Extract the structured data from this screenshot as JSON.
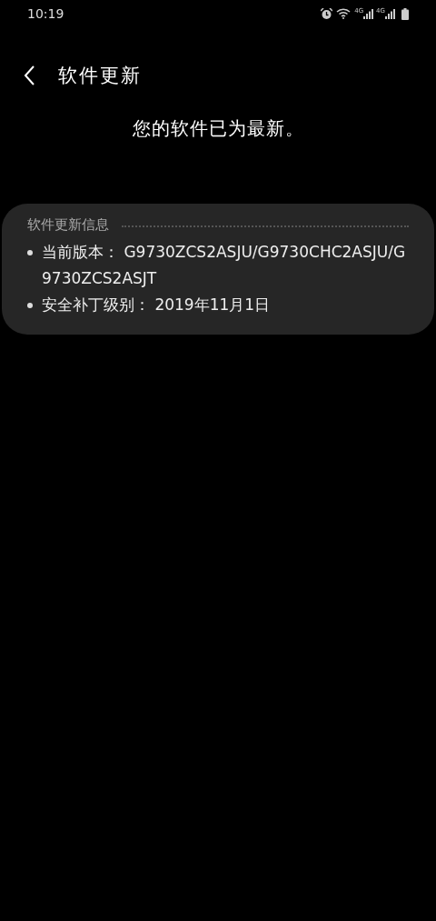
{
  "status_bar": {
    "time": "10:19",
    "network_labels": [
      "4G",
      "4G"
    ]
  },
  "header": {
    "title": "软件更新"
  },
  "message": "您的软件已为最新。",
  "info_card": {
    "title": "软件更新信息",
    "items": [
      {
        "label": "当前版本：",
        "value": "G9730ZCS2ASJU/G9730CHC2ASJU/G9730ZCS2ASJT"
      },
      {
        "label": "安全补丁级别：",
        "value": "2019年11月1日"
      }
    ]
  }
}
